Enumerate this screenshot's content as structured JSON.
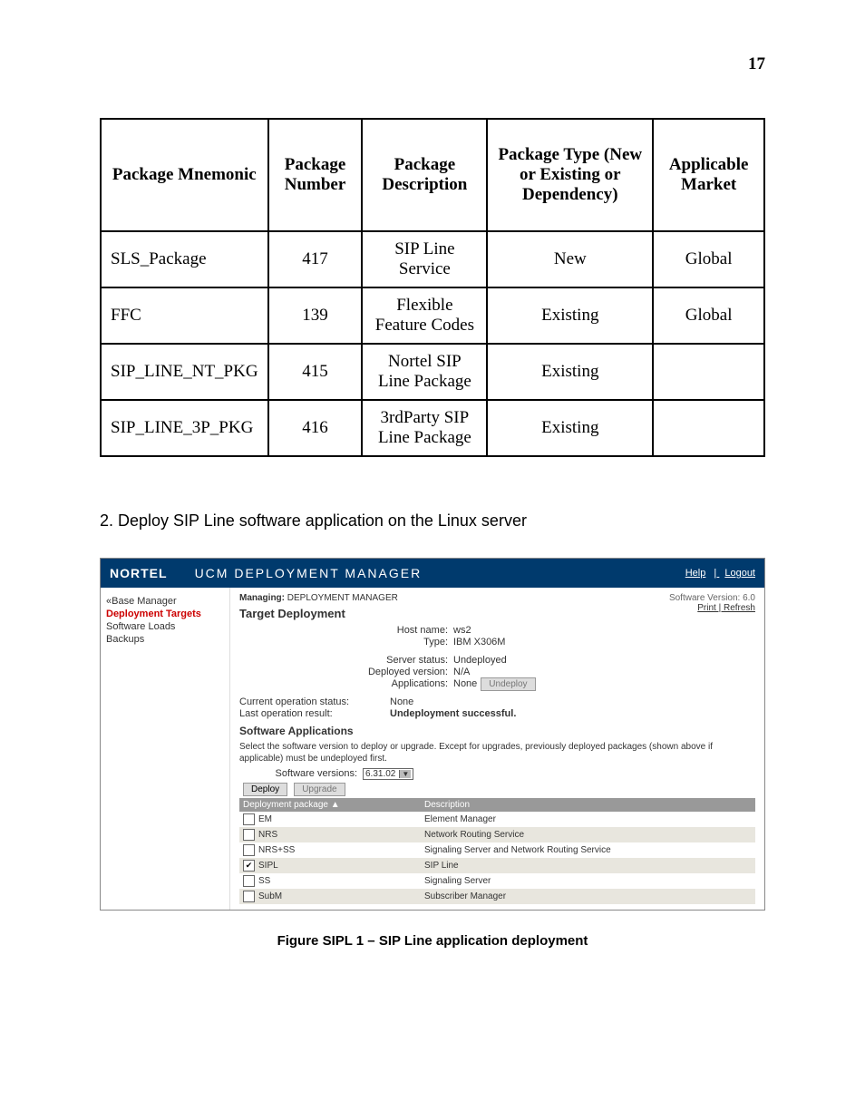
{
  "page_number": "17",
  "table": {
    "headers": [
      "Package Mnemonic",
      "Package Number",
      "Package Description",
      "Package Type (New or Existing or Dependency)",
      "Applicable Market"
    ],
    "rows": [
      {
        "mnemonic": "SLS_Package",
        "number": "417",
        "desc": "SIP Line Service",
        "type": "New",
        "market": "Global"
      },
      {
        "mnemonic": "FFC",
        "number": "139",
        "desc": "Flexible Feature Codes",
        "type": "Existing",
        "market": "Global"
      },
      {
        "mnemonic": "SIP_LINE_NT_PKG",
        "number": "415",
        "desc": "Nortel SIP Line Package",
        "type": "Existing",
        "market": ""
      },
      {
        "mnemonic": "SIP_LINE_3P_PKG",
        "number": "416",
        "desc": "3rdParty SIP Line Package",
        "type": "Existing",
        "market": ""
      }
    ]
  },
  "step_text": "2.   Deploy SIP Line software application on the Linux server",
  "screenshot": {
    "logo": "NORTEL",
    "title": "UCM DEPLOYMENT MANAGER",
    "header_links": {
      "help": "Help",
      "logout": "Logout"
    },
    "sidebar": {
      "base_manager": "«Base Manager",
      "deployment_targets": "Deployment Targets",
      "software_loads": "Software Loads",
      "backups": "Backups"
    },
    "managing_label": "Managing:",
    "managing_value": "DEPLOYMENT MANAGER",
    "software_version": "Software Version: 6.0",
    "target_deployment": "Target Deployment",
    "print_refresh": "Print | Refresh",
    "info": {
      "hostname_label": "Host name:",
      "hostname_value": "ws2",
      "type_label": "Type:",
      "type_value": "IBM X306M",
      "server_status_label": "Server status:",
      "server_status_value": "Undeployed",
      "deployed_version_label": "Deployed version:",
      "deployed_version_value": "N/A",
      "applications_label": "Applications:",
      "applications_value": "None",
      "undeploy_btn": "Undeploy",
      "current_op_label": "Current operation status:",
      "current_op_value": "None",
      "last_op_label": "Last operation result:",
      "last_op_value": "Undeployment successful."
    },
    "software_applications": "Software Applications",
    "note": "Select the software version to deploy or upgrade. Except for upgrades, previously deployed packages (shown above if applicable) must be undeployed first.",
    "sw_versions_label": "Software versions:",
    "sw_versions_value": "6.31.02",
    "deploy_btn": "Deploy",
    "upgrade_btn": "Upgrade",
    "pkg_header": {
      "col1": "Deployment package ▲",
      "col2": "Description"
    },
    "packages": [
      {
        "name": "EM",
        "desc": "Element Manager",
        "checked": false
      },
      {
        "name": "NRS",
        "desc": "Network Routing Service",
        "checked": false
      },
      {
        "name": "NRS+SS",
        "desc": "Signaling Server and Network Routing Service",
        "checked": false
      },
      {
        "name": "SIPL",
        "desc": "SIP Line",
        "checked": true
      },
      {
        "name": "SS",
        "desc": "Signaling Server",
        "checked": false
      },
      {
        "name": "SubM",
        "desc": "Subscriber Manager",
        "checked": false
      }
    ]
  },
  "figure_caption": "Figure SIPL 1 – SIP Line application deployment"
}
